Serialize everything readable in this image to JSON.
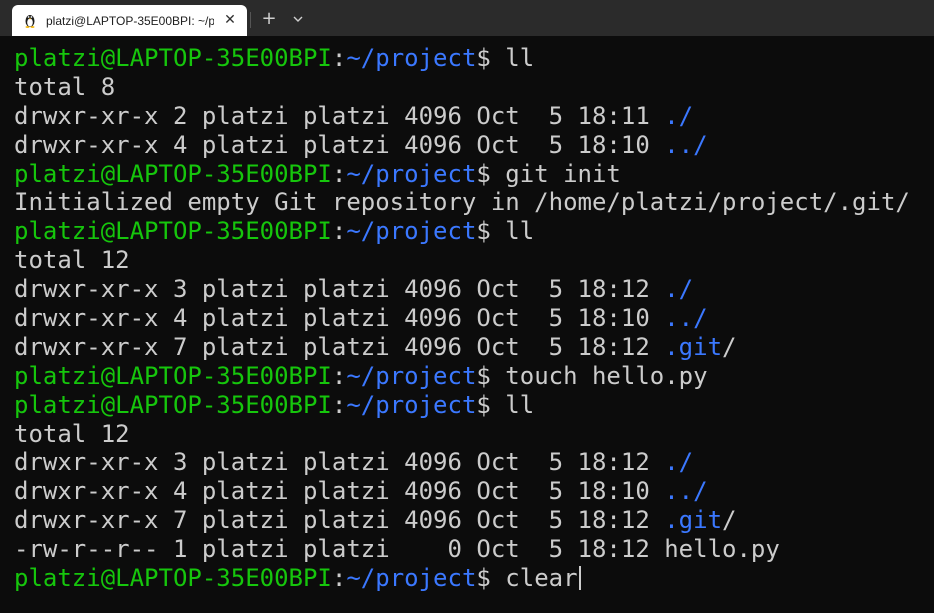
{
  "tab": {
    "title": "platzi@LAPTOP-35E00BPI: ~/p",
    "icon": "linux-penguin-icon",
    "close_glyph": "✕"
  },
  "toolbar": {
    "new_tab_glyph": "+",
    "dropdown_icon": "chevron-down-icon"
  },
  "colors": {
    "background": "#0c0c0c",
    "prompt_user": "#16c60c",
    "prompt_path": "#3b78ff",
    "text": "#cccccc"
  },
  "terminal": {
    "lines": [
      [
        {
          "t": "platzi@LAPTOP-35E00BPI",
          "c": "green"
        },
        {
          "t": ":",
          "c": "gray"
        },
        {
          "t": "~/project",
          "c": "blue"
        },
        {
          "t": "$ ll",
          "c": "gray"
        }
      ],
      [
        {
          "t": "total 8",
          "c": "gray"
        }
      ],
      [
        {
          "t": "drwxr-xr-x 2 platzi platzi 4096 Oct  5 18:11 ",
          "c": "gray"
        },
        {
          "t": "./",
          "c": "blue"
        }
      ],
      [
        {
          "t": "drwxr-xr-x 4 platzi platzi 4096 Oct  5 18:10 ",
          "c": "gray"
        },
        {
          "t": "../",
          "c": "blue"
        }
      ],
      [
        {
          "t": "platzi@LAPTOP-35E00BPI",
          "c": "green"
        },
        {
          "t": ":",
          "c": "gray"
        },
        {
          "t": "~/project",
          "c": "blue"
        },
        {
          "t": "$ git init",
          "c": "gray"
        }
      ],
      [
        {
          "t": "Initialized empty Git repository in /home/platzi/project/.git/",
          "c": "gray"
        }
      ],
      [
        {
          "t": "platzi@LAPTOP-35E00BPI",
          "c": "green"
        },
        {
          "t": ":",
          "c": "gray"
        },
        {
          "t": "~/project",
          "c": "blue"
        },
        {
          "t": "$ ll",
          "c": "gray"
        }
      ],
      [
        {
          "t": "total 12",
          "c": "gray"
        }
      ],
      [
        {
          "t": "drwxr-xr-x 3 platzi platzi 4096 Oct  5 18:12 ",
          "c": "gray"
        },
        {
          "t": "./",
          "c": "blue"
        }
      ],
      [
        {
          "t": "drwxr-xr-x 4 platzi platzi 4096 Oct  5 18:10 ",
          "c": "gray"
        },
        {
          "t": "../",
          "c": "blue"
        }
      ],
      [
        {
          "t": "drwxr-xr-x 7 platzi platzi 4096 Oct  5 18:12 ",
          "c": "gray"
        },
        {
          "t": ".git",
          "c": "blue"
        },
        {
          "t": "/",
          "c": "gray"
        }
      ],
      [
        {
          "t": "platzi@LAPTOP-35E00BPI",
          "c": "green"
        },
        {
          "t": ":",
          "c": "gray"
        },
        {
          "t": "~/project",
          "c": "blue"
        },
        {
          "t": "$ touch hello.py",
          "c": "gray"
        }
      ],
      [
        {
          "t": "platzi@LAPTOP-35E00BPI",
          "c": "green"
        },
        {
          "t": ":",
          "c": "gray"
        },
        {
          "t": "~/project",
          "c": "blue"
        },
        {
          "t": "$ ll",
          "c": "gray"
        }
      ],
      [
        {
          "t": "total 12",
          "c": "gray"
        }
      ],
      [
        {
          "t": "drwxr-xr-x 3 platzi platzi 4096 Oct  5 18:12 ",
          "c": "gray"
        },
        {
          "t": "./",
          "c": "blue"
        }
      ],
      [
        {
          "t": "drwxr-xr-x 4 platzi platzi 4096 Oct  5 18:10 ",
          "c": "gray"
        },
        {
          "t": "../",
          "c": "blue"
        }
      ],
      [
        {
          "t": "drwxr-xr-x 7 platzi platzi 4096 Oct  5 18:12 ",
          "c": "gray"
        },
        {
          "t": ".git",
          "c": "blue"
        },
        {
          "t": "/",
          "c": "gray"
        }
      ],
      [
        {
          "t": "-rw-r--r-- 1 platzi platzi    0 Oct  5 18:12 hello.py",
          "c": "gray"
        }
      ],
      [
        {
          "t": "platzi@LAPTOP-35E00BPI",
          "c": "green"
        },
        {
          "t": ":",
          "c": "gray"
        },
        {
          "t": "~/project",
          "c": "blue"
        },
        {
          "t": "$ clear",
          "c": "gray"
        }
      ]
    ]
  }
}
